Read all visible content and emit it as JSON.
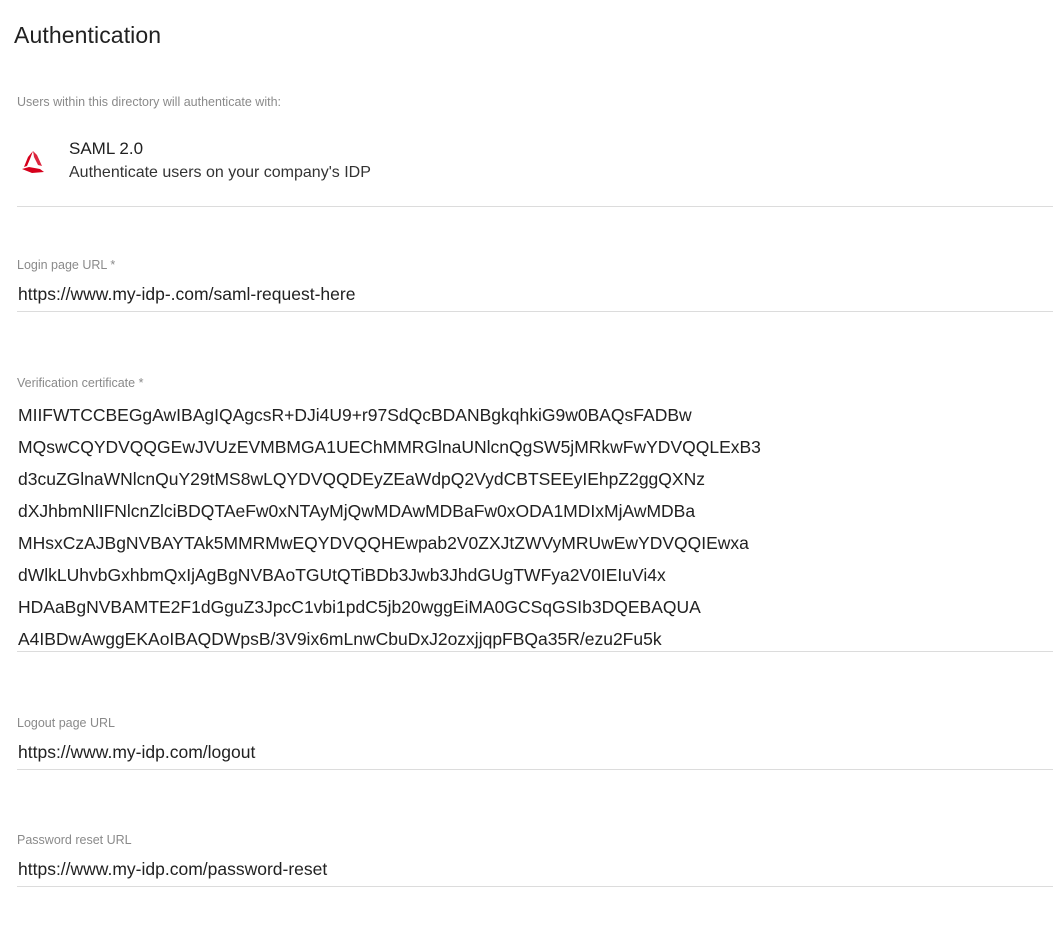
{
  "page": {
    "title": "Authentication",
    "intro": "Users within this directory will authenticate with:"
  },
  "auth_method": {
    "name": "SAML 2.0",
    "description": "Authenticate users on your company's IDP",
    "icon": "saml-logo-icon",
    "icon_color": "#d6001c"
  },
  "fields": {
    "login_url": {
      "label": "Login page URL *",
      "value": "https://www.my-idp-.com/saml-request-here"
    },
    "certificate": {
      "label": "Verification certificate *",
      "lines": [
        "MIIFWTCCBEGgAwIBAgIQAgcsR+DJi4U9+r97SdQcBDANBgkqhkiG9w0BAQsFADBw",
        "MQswCQYDVQQGEwJVUzEVMBMGA1UEChMMRGlnaUNlcnQgSW5jMRkwFwYDVQQLExB3",
        "d3cuZGlnaWNlcnQuY29tMS8wLQYDVQQDEyZEaWdpQ2VydCBTSEEyIEhpZ2ggQXNz",
        "dXJhbmNlIFNlcnZlciBDQTAeFw0xNTAyMjQwMDAwMDBaFw0xODA1MDIxMjAwMDBa",
        "MHsxCzAJBgNVBAYTAk5MMRMwEQYDVQQHEwpab2V0ZXJtZWVyMRUwEwYDVQQIEwxa",
        "dWlkLUhvbGxhbmQxIjAgBgNVBAoTGUtQTiBDb3Jwb3JhdGUgTWFya2V0IEIuVi4x",
        "HDAaBgNVBAMTE2F1dGguZ3JpcC1vbi1pdC5jb20wggEiMA0GCSqGSIb3DQEBAQUA",
        "A4IBDwAwggEKAoIBAQDWpsB/3V9ix6mLnwCbuDxJ2ozxjjqpFBQa35R/ezu2Fu5k"
      ]
    },
    "logout_url": {
      "label": "Logout page URL",
      "value": "https://www.my-idp.com/logout"
    },
    "password_reset_url": {
      "label": "Password reset URL",
      "value": "https://www.my-idp.com/password-reset"
    }
  }
}
